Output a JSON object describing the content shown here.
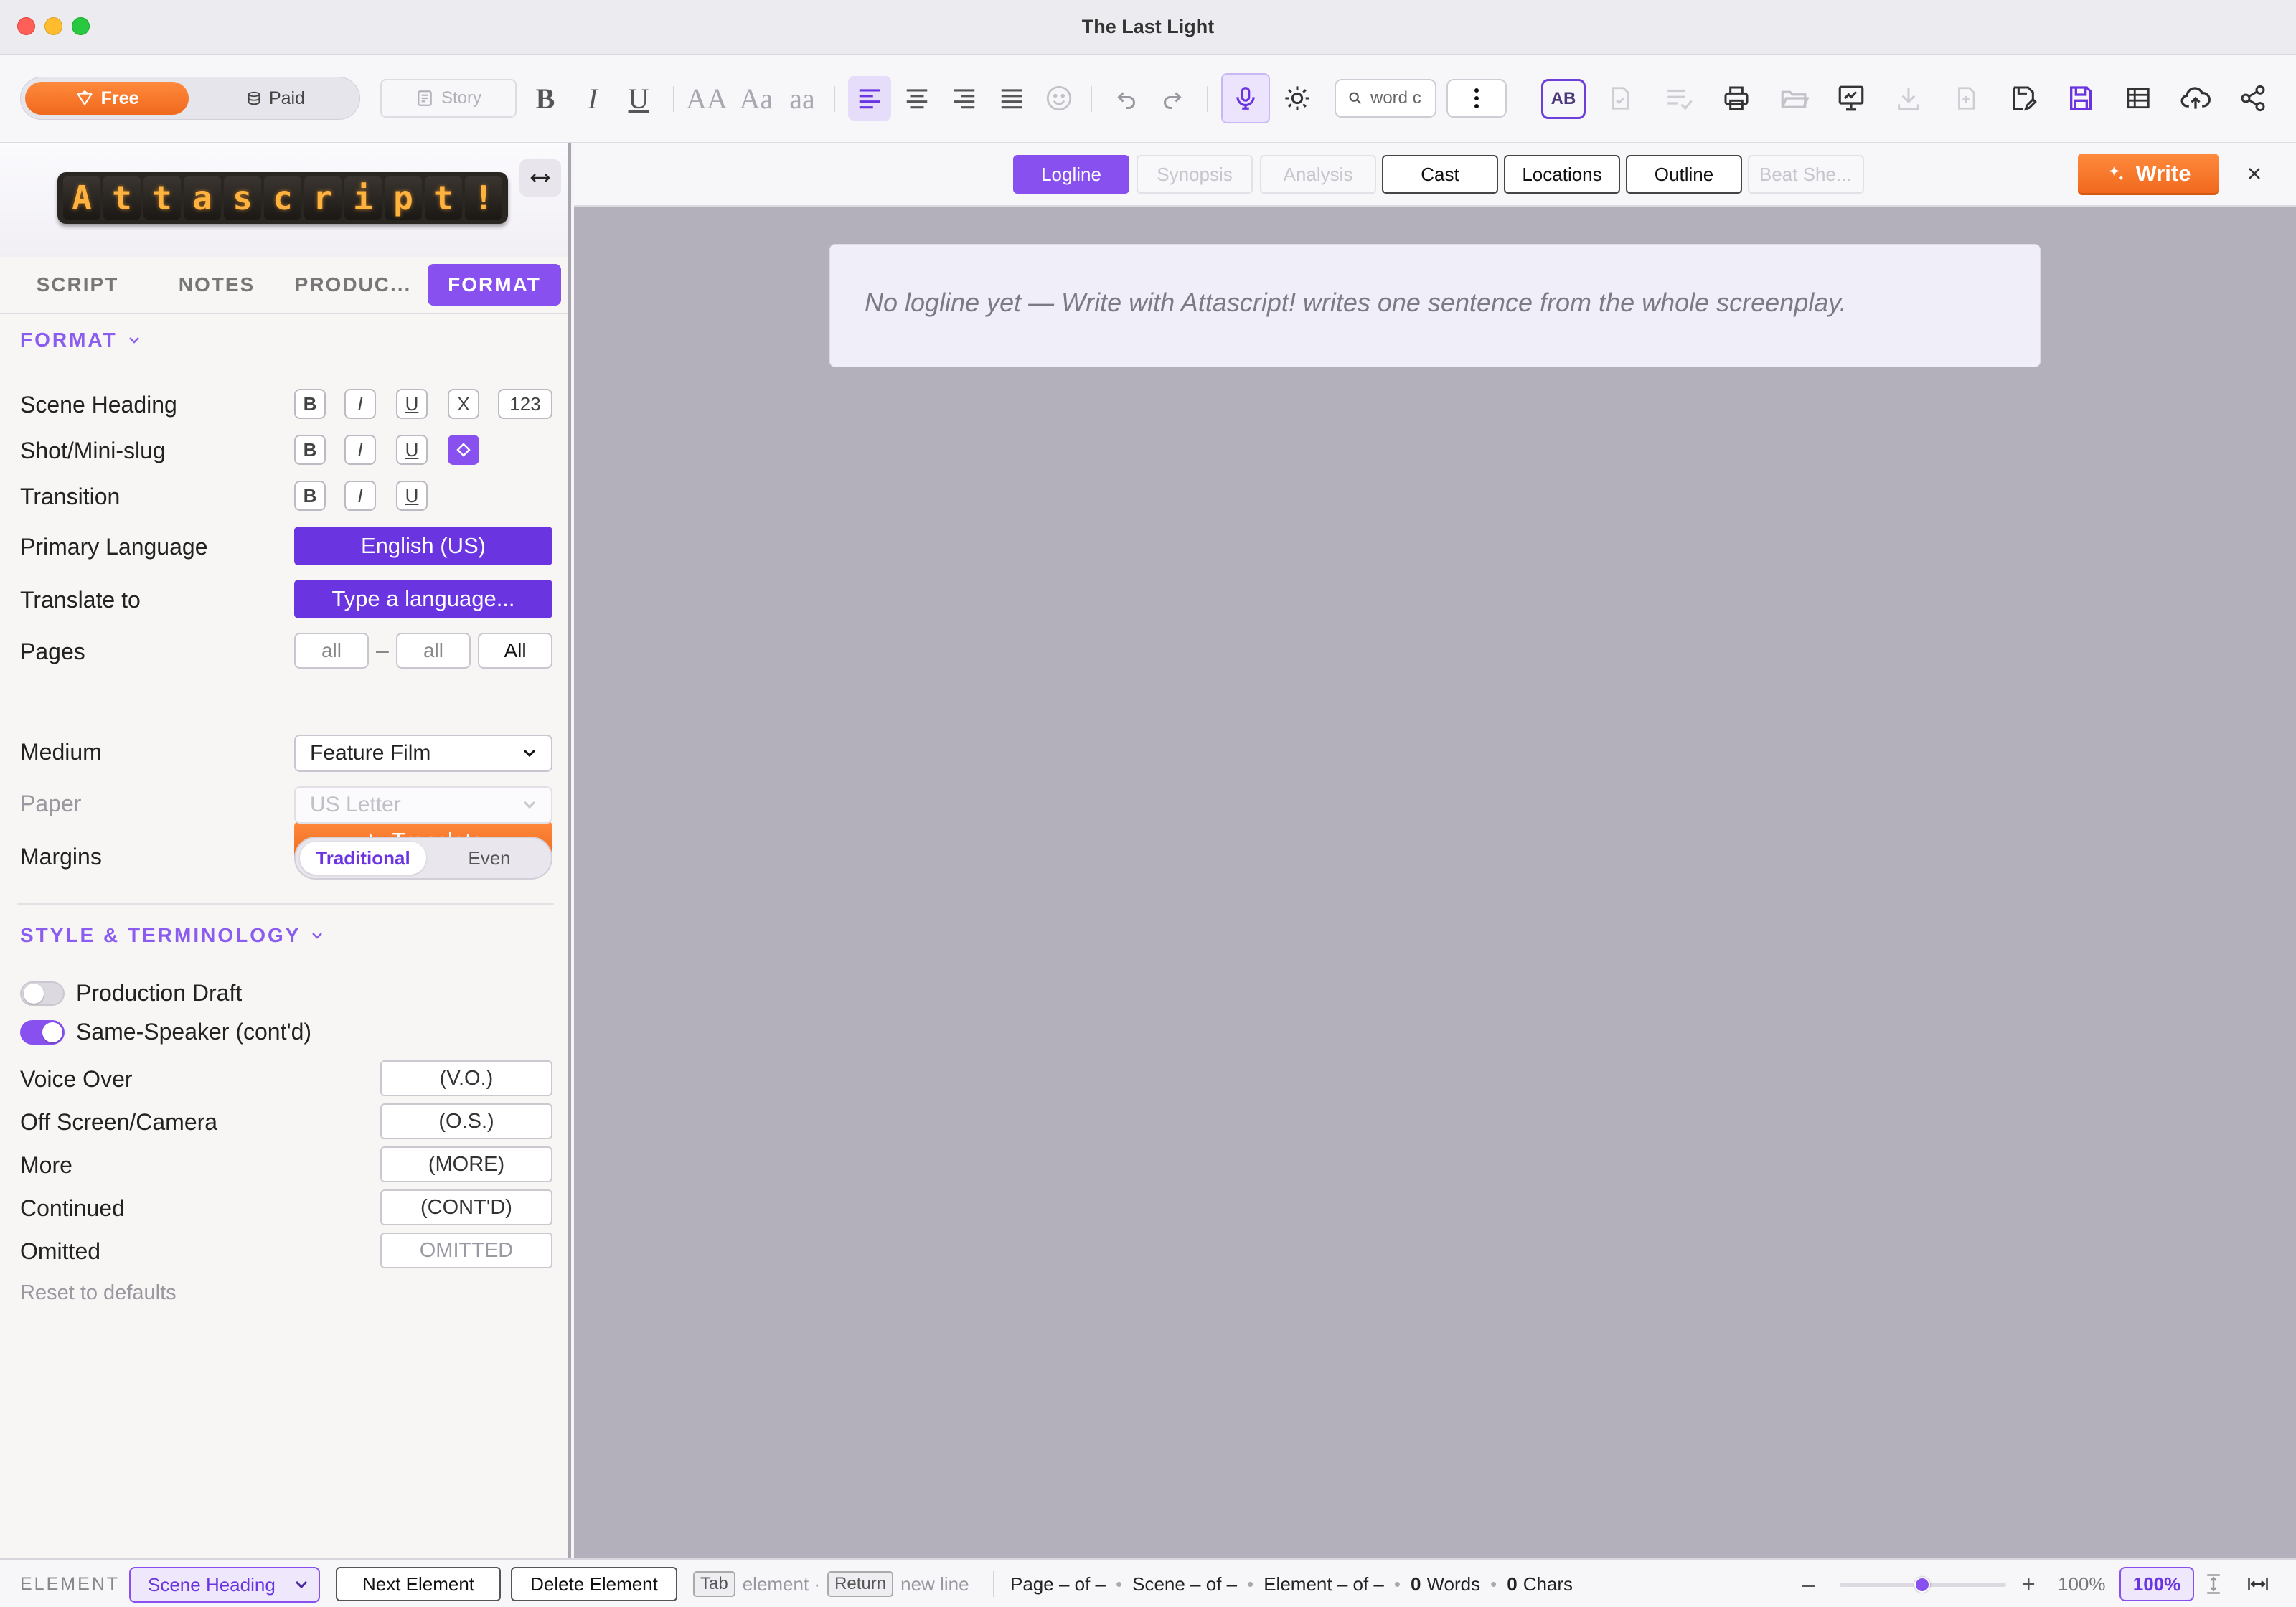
{
  "window": {
    "title": "The Last Light"
  },
  "toolbar": {
    "plan_free": "Free",
    "plan_paid": "Paid",
    "story_label": "Story",
    "bold_label": "B",
    "italic_label": "I",
    "underline_label": "U",
    "case_upper": "AA",
    "case_title": "Aa",
    "case_lower": "aa",
    "search_placeholder": "word c",
    "spellcheck_label": "AB"
  },
  "sidebar": {
    "logo_letters": [
      "A",
      "t",
      "t",
      "a",
      "s",
      "c",
      "r",
      "i",
      "p",
      "t",
      "!"
    ],
    "tabs": [
      {
        "label": "SCRIPT"
      },
      {
        "label": "NOTES"
      },
      {
        "label": "PRODUC..."
      },
      {
        "label": "FORMAT",
        "active": true
      }
    ],
    "format": {
      "section_title": "FORMAT",
      "scene_heading": "Scene Heading",
      "shot_mini_slug": "Shot/Mini-slug",
      "transition": "Transition",
      "btn_bold": "B",
      "btn_italic": "I",
      "btn_underline": "U",
      "btn_clear": "X",
      "btn_numbering": "123",
      "primary_language_label": "Primary Language",
      "primary_language_value": "English (US)",
      "translate_to_label": "Translate to",
      "translate_to_placeholder": "Type a language...",
      "pages_label": "Pages",
      "pages_from": "all",
      "pages_dash": "–",
      "pages_to": "all",
      "pages_all_button": "All",
      "translate_button": "Translate",
      "medium_label": "Medium",
      "medium_value": "Feature Film",
      "paper_label": "Paper",
      "paper_value": "US Letter",
      "margins_label": "Margins",
      "margins_traditional": "Traditional",
      "margins_even": "Even"
    },
    "style": {
      "section_title": "STYLE & TERMINOLOGY",
      "production_draft": "Production Draft",
      "production_draft_on": false,
      "same_speaker": "Same-Speaker (cont'd)",
      "same_speaker_on": true,
      "terms": [
        {
          "label": "Voice Over",
          "value": "(V.O.)"
        },
        {
          "label": "Off Screen/Camera",
          "value": "(O.S.)"
        },
        {
          "label": "More",
          "value": "(MORE)"
        },
        {
          "label": "Continued",
          "value": "(CONT'D)"
        },
        {
          "label": "Omitted",
          "value": "OMITTED"
        }
      ],
      "reset_link": "Reset to defaults"
    }
  },
  "main": {
    "tabs": [
      {
        "label": "Logline",
        "state": "active"
      },
      {
        "label": "Synopsis",
        "state": "disabled"
      },
      {
        "label": "Analysis",
        "state": "disabled"
      },
      {
        "label": "Cast",
        "state": "normal"
      },
      {
        "label": "Locations",
        "state": "normal"
      },
      {
        "label": "Outline",
        "state": "normal"
      },
      {
        "label": "Beat She...",
        "state": "disabled"
      }
    ],
    "write_button": "Write",
    "logline_placeholder": "No logline yet — Write with Attascript! writes one sentence from the whole screenplay."
  },
  "statusbar": {
    "element_label": "ELEMENT",
    "element_value": "Scene Heading",
    "next_element": "Next Element",
    "delete_element": "Delete Element",
    "tab_key": "Tab",
    "tab_hint": "element ·",
    "return_key": "Return",
    "return_hint": "new line",
    "page": "Page – of –",
    "scene": "Scene – of –",
    "element": "Element – of –",
    "words_count": "0",
    "words_label": "Words",
    "chars_count": "0",
    "chars_label": "Chars",
    "zoom_minus": "–",
    "zoom_plus": "+",
    "zoom_text": "100%",
    "zoom_value": "100%"
  },
  "colors": {
    "accent_purple": "#8750ef",
    "deep_purple": "#6a35e0",
    "accent_orange": "#f0691d",
    "canvas_gray": "#b3b0bb"
  }
}
